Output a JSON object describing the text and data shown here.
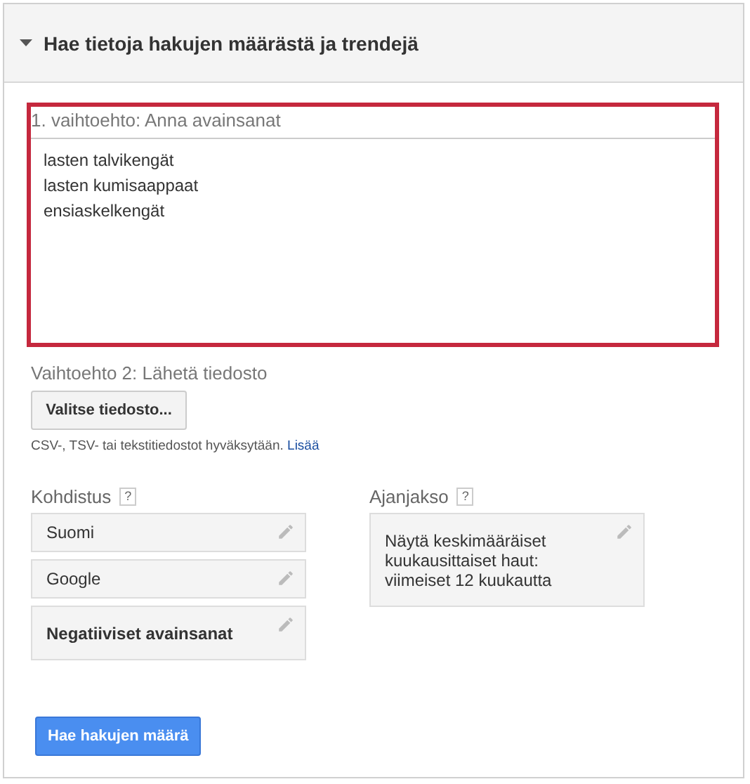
{
  "section": {
    "title": "Hae tietoja hakujen määrästä ja trendejä",
    "expanded": true
  },
  "option1": {
    "label": "1. vaihtoehto: Anna avainsanat",
    "highlighted": true,
    "keywords": [
      "lasten talvikengät",
      "lasten kumisaappaat",
      "ensiaskelkengät"
    ]
  },
  "option2": {
    "label": "Vaihtoehto 2: Lähetä tiedosto",
    "button": "Valitse tiedosto...",
    "note": "CSV-, TSV- tai tekstitiedostot hyväksytään.",
    "link": "Lisää"
  },
  "targeting": {
    "label": "Kohdistus",
    "help": "?",
    "items": [
      {
        "text": "Suomi",
        "bold": false
      },
      {
        "text": "Google",
        "bold": false
      },
      {
        "text": "Negatiiviset avainsanat",
        "bold": true
      }
    ]
  },
  "period": {
    "label": "Ajanjakso",
    "help": "?",
    "text": "Näytä keskimääräiset kuukausittaiset haut: viimeiset 12 kuukautta"
  },
  "submit": "Hae hakujen määrä"
}
